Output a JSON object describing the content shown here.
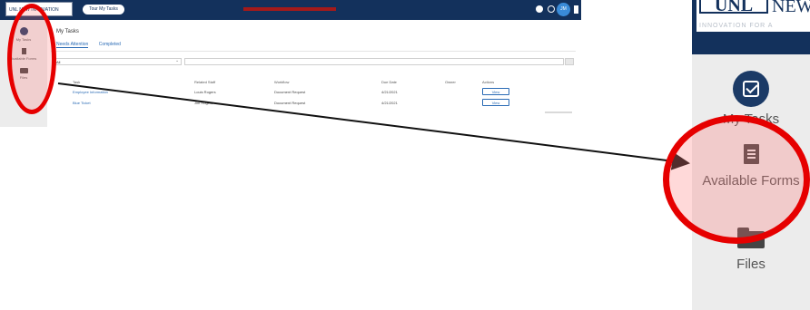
{
  "app": {
    "logo_text": "UNL NEW INNOVATION",
    "tour_button": "Tour My Tasks",
    "user_initials": "JM"
  },
  "sidebar": {
    "items": [
      {
        "label": "My Tasks",
        "icon": "tasks-icon"
      },
      {
        "label": "Available Forms",
        "icon": "forms-icon"
      },
      {
        "label": "Files",
        "icon": "folder-icon"
      }
    ]
  },
  "main": {
    "title": "My Tasks",
    "tabs": [
      {
        "label": "Needs Attention",
        "active": true
      },
      {
        "label": "Completed",
        "active": false
      }
    ],
    "filter": {
      "selected": "All",
      "search_value": ""
    },
    "table": {
      "columns": [
        "Task",
        "Related Staff",
        "Workflow",
        "Due Date",
        "Owner",
        "Actions"
      ],
      "rows": [
        {
          "task": "Employee Information",
          "staff": "Louis Rogers",
          "workflow": "Document Request",
          "due": "4/21/2021",
          "owner": "",
          "action": "View"
        },
        {
          "task": "Blue Ticket",
          "staff": "Jim Rogers",
          "workflow": "Document Request",
          "due": "4/21/2021",
          "owner": "",
          "action": "View"
        }
      ]
    }
  },
  "zoom": {
    "logo_mark": "UNL",
    "logo_word": "NEW",
    "logo_tagline": "INNOVATION FOR A"
  },
  "colors": {
    "header": "#13315c",
    "sidebar": "#ececec",
    "highlight": "#e60000",
    "link": "#2a6bb5"
  }
}
